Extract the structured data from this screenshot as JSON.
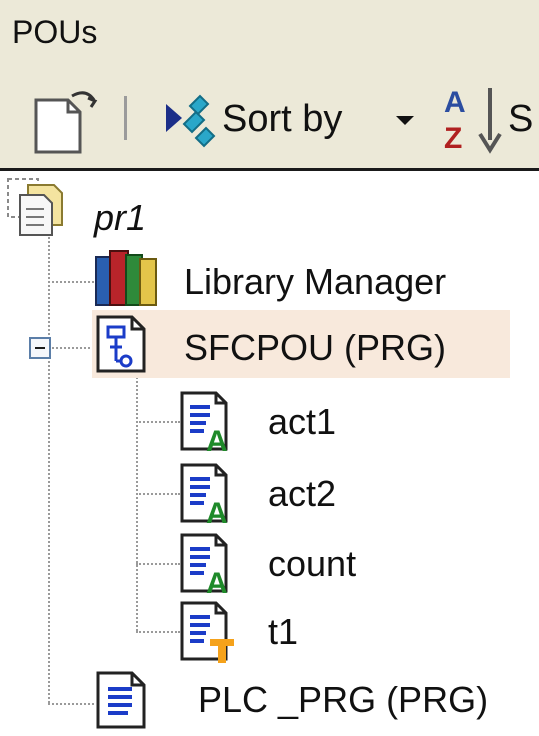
{
  "panel": {
    "title": "POUs"
  },
  "toolbar": {
    "new_icon": "new-document-icon",
    "sort_label": "Sort by",
    "sort_icon": "sort-icon",
    "sort_az_icon": "sort-az-icon",
    "truncated_label": "S"
  },
  "tree": {
    "root": {
      "label": "pr1",
      "icon": "project-icon"
    },
    "items": [
      {
        "label": "Library Manager",
        "icon": "library-books-icon"
      },
      {
        "label": "SFCPOU (PRG)",
        "icon": "sfc-program-icon",
        "expanded": true,
        "children": [
          {
            "label": "act1",
            "icon": "action-icon"
          },
          {
            "label": "act2",
            "icon": "action-icon"
          },
          {
            "label": "count",
            "icon": "action-icon"
          },
          {
            "label": "t1",
            "icon": "transition-icon"
          }
        ]
      },
      {
        "label": "PLC _PRG (PRG)",
        "icon": "program-icon"
      }
    ]
  },
  "colors": {
    "panel_bg": "#ece9d8",
    "selection": "#f8e9dc",
    "action_green": "#1f8a2a",
    "transition_orange": "#f5a21b"
  }
}
